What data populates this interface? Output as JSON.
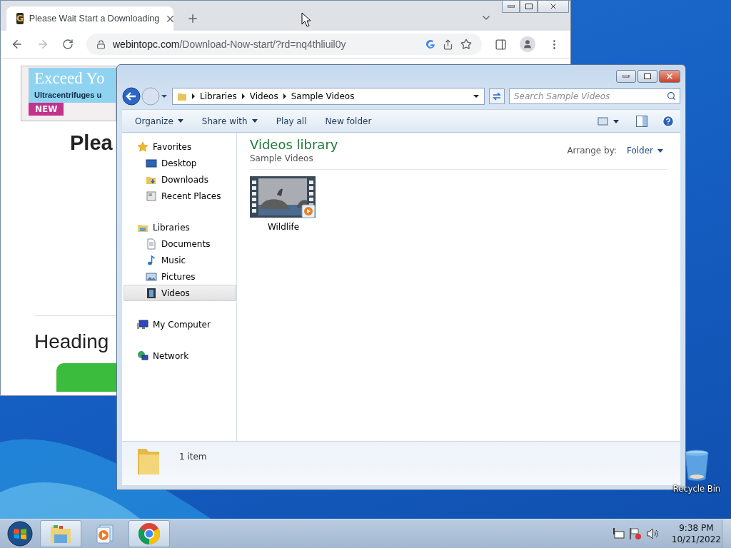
{
  "browser": {
    "tab": {
      "favicon": "G",
      "title": "Please Wait Start a Downloading"
    },
    "address": {
      "host": "webintopc.com",
      "path": "/Download-Now-start/?rd=nq4thliuil0y"
    },
    "page": {
      "ad": {
        "headline": "Exceed Yo",
        "subline": "Ultracentrifuges u",
        "badge": "NEW"
      },
      "title": "Plea",
      "heading": "Heading"
    }
  },
  "explorer": {
    "breadcrumb": [
      "Libraries",
      "Videos",
      "Sample Videos"
    ],
    "search": {
      "placeholder": "Search Sample Videos"
    },
    "toolbar": [
      {
        "label": "Organize",
        "menu": true
      },
      {
        "label": "Share with",
        "menu": true
      },
      {
        "label": "Play all",
        "menu": false
      },
      {
        "label": "New folder",
        "menu": false
      }
    ],
    "nav": [
      {
        "label": "Favorites",
        "kind": "star",
        "selected": false,
        "children": [
          {
            "label": "Desktop",
            "kind": "desktop",
            "selected": false
          },
          {
            "label": "Downloads",
            "kind": "downloads",
            "selected": false
          },
          {
            "label": "Recent Places",
            "kind": "recent",
            "selected": false
          }
        ]
      },
      {
        "label": "Libraries",
        "kind": "library",
        "selected": false,
        "children": [
          {
            "label": "Documents",
            "kind": "document",
            "selected": false
          },
          {
            "label": "Music",
            "kind": "music",
            "selected": false
          },
          {
            "label": "Pictures",
            "kind": "pictures",
            "selected": false
          },
          {
            "label": "Videos",
            "kind": "videos",
            "selected": true
          }
        ]
      },
      {
        "label": "My Computer",
        "kind": "computer",
        "selected": false
      },
      {
        "label": "Network",
        "kind": "network",
        "selected": false
      }
    ],
    "library": {
      "title": "Videos library",
      "subtitle": "Sample Videos",
      "arrange_label": "Arrange by:",
      "arrange_value": "Folder"
    },
    "items": [
      {
        "name": "Wildlife",
        "kind": "video"
      }
    ],
    "status": "1 item"
  },
  "desktop_icons": [
    {
      "label": "Recycle Bin",
      "kind": "recycle"
    }
  ],
  "taskbar": {
    "apps": [
      {
        "kind": "explorer",
        "running": true
      },
      {
        "kind": "media",
        "running": false
      },
      {
        "kind": "chrome",
        "running": true
      }
    ],
    "time": "9:38 PM",
    "date": "10/21/2022"
  }
}
